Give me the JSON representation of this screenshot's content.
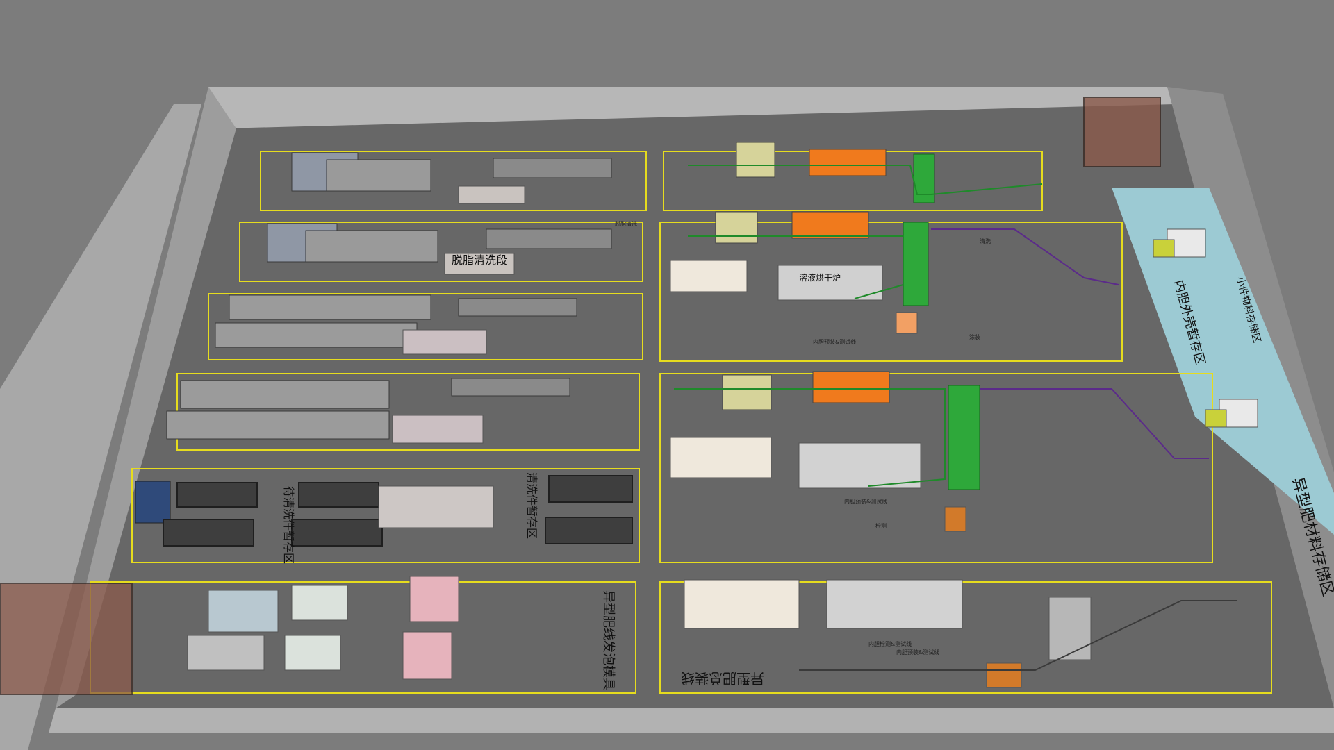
{
  "scene": {
    "colors": {
      "background": "#7c7c7c",
      "floor": "#666666",
      "wall": "#b9b9b9",
      "zone_line": "#e6dc1e",
      "storage_zone": "#9ccad3",
      "pipe_green": "#1f8a2a",
      "pipe_purple": "#5b2a8a",
      "accent_orange": "#f07a1d"
    },
    "icons": [
      "rack-icon",
      "machine-icon",
      "oven-icon",
      "tank-icon",
      "pipe-icon"
    ]
  },
  "labels": {
    "degrease": "脱脂清洗段",
    "drying_oven": "溶液烘干炉",
    "wait_clean_storage": "待清洗件暂存区",
    "cleaned_storage": "清洗件暂存区",
    "foam_mold": "异型肥线发泡模具",
    "assembly_line": "异型肥总装线",
    "large_storage": "异型肥材料存储区",
    "inner_shell_storage": "内胆外壳暂存区",
    "small_parts_storage": "小件物料存储区",
    "test_line_1": "内胆预装&测试线",
    "test_line_2": "内胆预装&测试线",
    "test_line_3": "内胆预装&测试线",
    "small_a": "脱脂清洗",
    "small_b": "清洗",
    "small_c": "涂装",
    "small_d": "检测",
    "small_e": "内胆检测&测试线"
  }
}
